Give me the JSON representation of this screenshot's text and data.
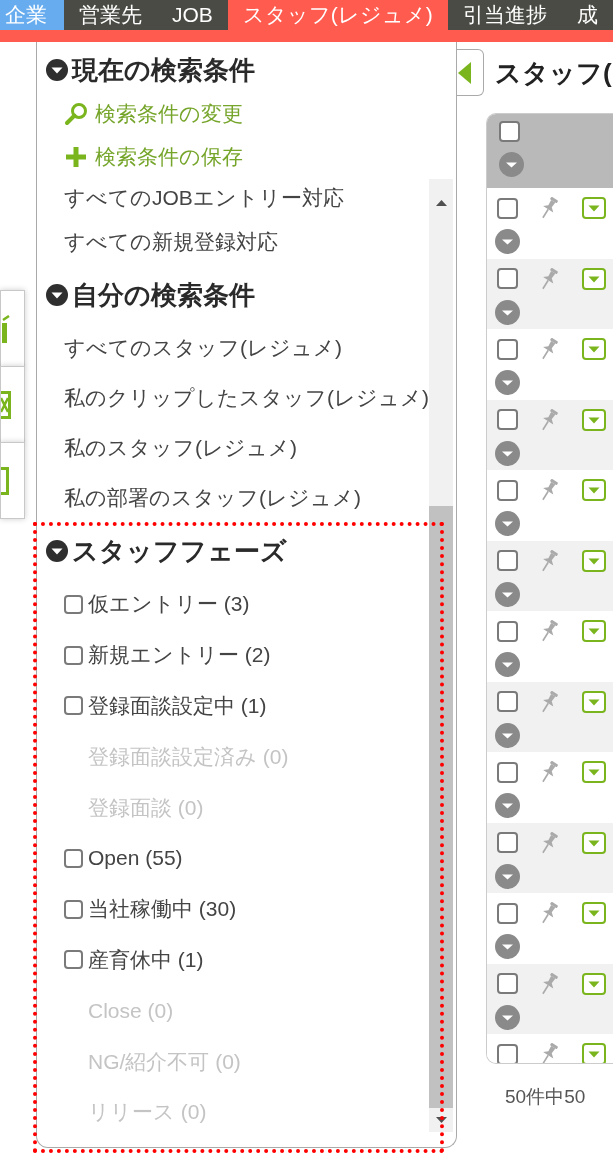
{
  "nav": {
    "tabs": [
      {
        "label": "企業",
        "selected": false,
        "highlighted": true
      },
      {
        "label": "営業先",
        "selected": false,
        "highlighted": false
      },
      {
        "label": "JOB",
        "selected": false,
        "highlighted": false
      },
      {
        "label": "スタッフ(レジュメ)",
        "selected": true,
        "highlighted": false
      },
      {
        "label": "引当進捗",
        "selected": false,
        "highlighted": false
      },
      {
        "label": "成",
        "selected": false,
        "highlighted": false
      }
    ]
  },
  "side_tools": [
    {
      "kind": "bar"
    },
    {
      "kind": "x-box"
    },
    {
      "kind": "square"
    }
  ],
  "sidebar": {
    "current": {
      "title": "現在の検索条件",
      "expanded": true,
      "links": [
        {
          "kind": "search",
          "label": "検索条件の変更"
        },
        {
          "kind": "add",
          "label": "検索条件の保存"
        }
      ]
    },
    "list": {
      "items": [
        "すべてのJOBエントリー対応",
        "すべての新規登録対応"
      ],
      "groups": [
        {
          "title": "自分の検索条件",
          "expanded": true,
          "kind": "links",
          "items": [
            {
              "label": "すべてのスタッフ(レジュメ)"
            },
            {
              "label": "私のクリップしたスタッフ(レジュメ)"
            },
            {
              "label": "私のスタッフ(レジュメ)"
            },
            {
              "label": "私の部署のスタッフ(レジュメ)"
            }
          ]
        },
        {
          "title": "スタッフフェーズ",
          "expanded": true,
          "kind": "checkboxes",
          "highlighted": true,
          "items": [
            {
              "label": "仮エントリー (3)",
              "disabled": false,
              "checked": false
            },
            {
              "label": "新規エントリー (2)",
              "disabled": false,
              "checked": false
            },
            {
              "label": "登録面談設定中 (1)",
              "disabled": false,
              "checked": false
            },
            {
              "label": "登録面談設定済み (0)",
              "disabled": true
            },
            {
              "label": "登録面談 (0)",
              "disabled": true
            },
            {
              "label": "Open (55)",
              "disabled": false,
              "checked": false
            },
            {
              "label": "当社稼働中 (30)",
              "disabled": false,
              "checked": false
            },
            {
              "label": "産育休中 (1)",
              "disabled": false,
              "checked": false
            },
            {
              "label": "Close (0)",
              "disabled": true
            },
            {
              "label": "NG/紹介不可 (0)",
              "disabled": true
            },
            {
              "label": "リリース (0)",
              "disabled": true
            }
          ]
        }
      ]
    }
  },
  "main": {
    "title": "スタッフ(",
    "table": {
      "header": {
        "checked": false
      },
      "rows": [
        {
          "checked": false,
          "pinned": false
        },
        {
          "checked": false,
          "pinned": false
        },
        {
          "checked": false,
          "pinned": false
        },
        {
          "checked": false,
          "pinned": false
        },
        {
          "checked": false,
          "pinned": false
        },
        {
          "checked": false,
          "pinned": false
        },
        {
          "checked": false,
          "pinned": false
        },
        {
          "checked": false,
          "pinned": false
        },
        {
          "checked": false,
          "pinned": false
        },
        {
          "checked": false,
          "pinned": false
        },
        {
          "checked": false,
          "pinned": false
        },
        {
          "checked": false,
          "pinned": false
        },
        {
          "checked": false,
          "pinned": false
        }
      ]
    },
    "footer": "50件中50"
  }
}
